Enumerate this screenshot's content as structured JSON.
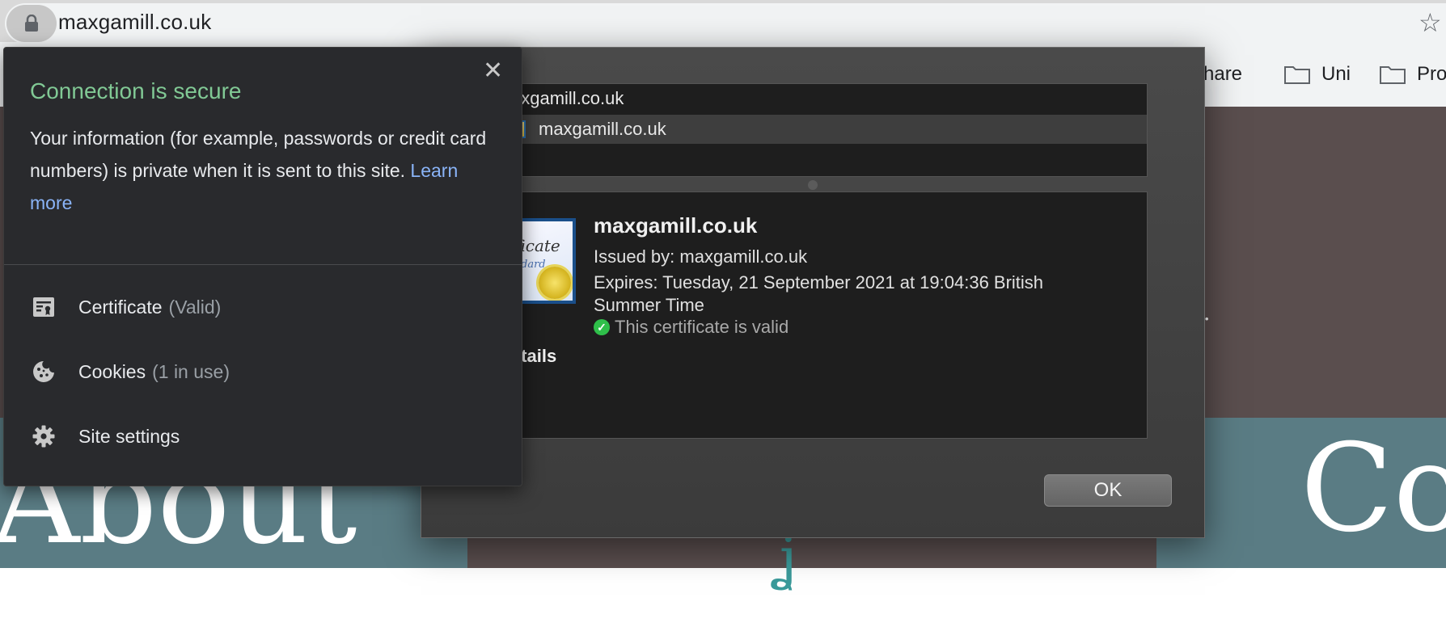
{
  "browser": {
    "url": "maxgamill.co.uk",
    "bookmarks": [
      {
        "label": "rshare"
      },
      {
        "label": "Uni"
      },
      {
        "label": "Pro"
      }
    ]
  },
  "page": {
    "left_heading": "About",
    "right_heading": "Co",
    "fragment": "rs."
  },
  "site_info": {
    "title": "Connection is secure",
    "body": "Your information (for example, passwords or credit card numbers) is private when it is sent to this site.",
    "learn_more": "Learn more",
    "items": [
      {
        "label": "Certificate",
        "detail": "(Valid)",
        "icon": "certificate-icon"
      },
      {
        "label": "Cookies",
        "detail": "(1 in use)",
        "icon": "cookie-icon"
      },
      {
        "label": "Site settings",
        "detail": "",
        "icon": "gear-icon"
      }
    ],
    "colors": {
      "title": "#81c995",
      "link": "#8ab4f8"
    }
  },
  "certificate_dialog": {
    "tree": [
      {
        "label": "axgamill.co.uk"
      },
      {
        "label": "maxgamill.co.uk"
      }
    ],
    "cert_image_text": "ificate",
    "cert_image_subtext": "dard",
    "name": "maxgamill.co.uk",
    "issued_by": "Issued by: maxgamill.co.uk",
    "expires": "Expires: Tuesday, 21 September 2021 at 19:04:36 British Summer Time",
    "valid": "This certificate is valid",
    "details": "etails",
    "ok": "OK"
  }
}
